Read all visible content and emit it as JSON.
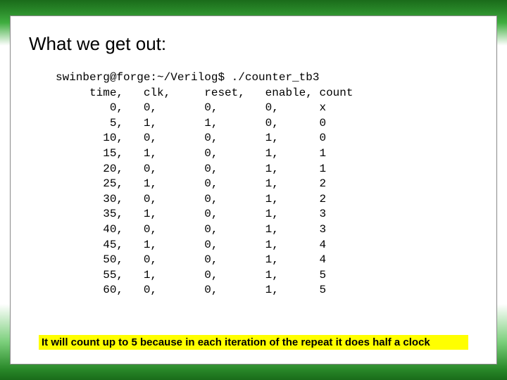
{
  "title": "What we get out:",
  "command": "swinberg@forge:~/Verilog$ ./counter_tb3",
  "columns": {
    "time": "time,",
    "clk": "clk,",
    "reset": "reset,",
    "enable": "enable,",
    "count": "count"
  },
  "rows": [
    {
      "time": "0,",
      "clk": "0,",
      "reset": "0,",
      "enable": "0,",
      "count": "x"
    },
    {
      "time": "5,",
      "clk": "1,",
      "reset": "1,",
      "enable": "0,",
      "count": "0"
    },
    {
      "time": "10,",
      "clk": "0,",
      "reset": "0,",
      "enable": "1,",
      "count": "0"
    },
    {
      "time": "15,",
      "clk": "1,",
      "reset": "0,",
      "enable": "1,",
      "count": "1"
    },
    {
      "time": "20,",
      "clk": "0,",
      "reset": "0,",
      "enable": "1,",
      "count": "1"
    },
    {
      "time": "25,",
      "clk": "1,",
      "reset": "0,",
      "enable": "1,",
      "count": "2"
    },
    {
      "time": "30,",
      "clk": "0,",
      "reset": "0,",
      "enable": "1,",
      "count": "2"
    },
    {
      "time": "35,",
      "clk": "1,",
      "reset": "0,",
      "enable": "1,",
      "count": "3"
    },
    {
      "time": "40,",
      "clk": "0,",
      "reset": "0,",
      "enable": "1,",
      "count": "3"
    },
    {
      "time": "45,",
      "clk": "1,",
      "reset": "0,",
      "enable": "1,",
      "count": "4"
    },
    {
      "time": "50,",
      "clk": "0,",
      "reset": "0,",
      "enable": "1,",
      "count": "4"
    },
    {
      "time": "55,",
      "clk": "1,",
      "reset": "0,",
      "enable": "1,",
      "count": "5"
    },
    {
      "time": "60,",
      "clk": "0,",
      "reset": "0,",
      "enable": "1,",
      "count": "5"
    }
  ],
  "note": "It will count up to 5 because in each iteration of the repeat it does half a clock"
}
